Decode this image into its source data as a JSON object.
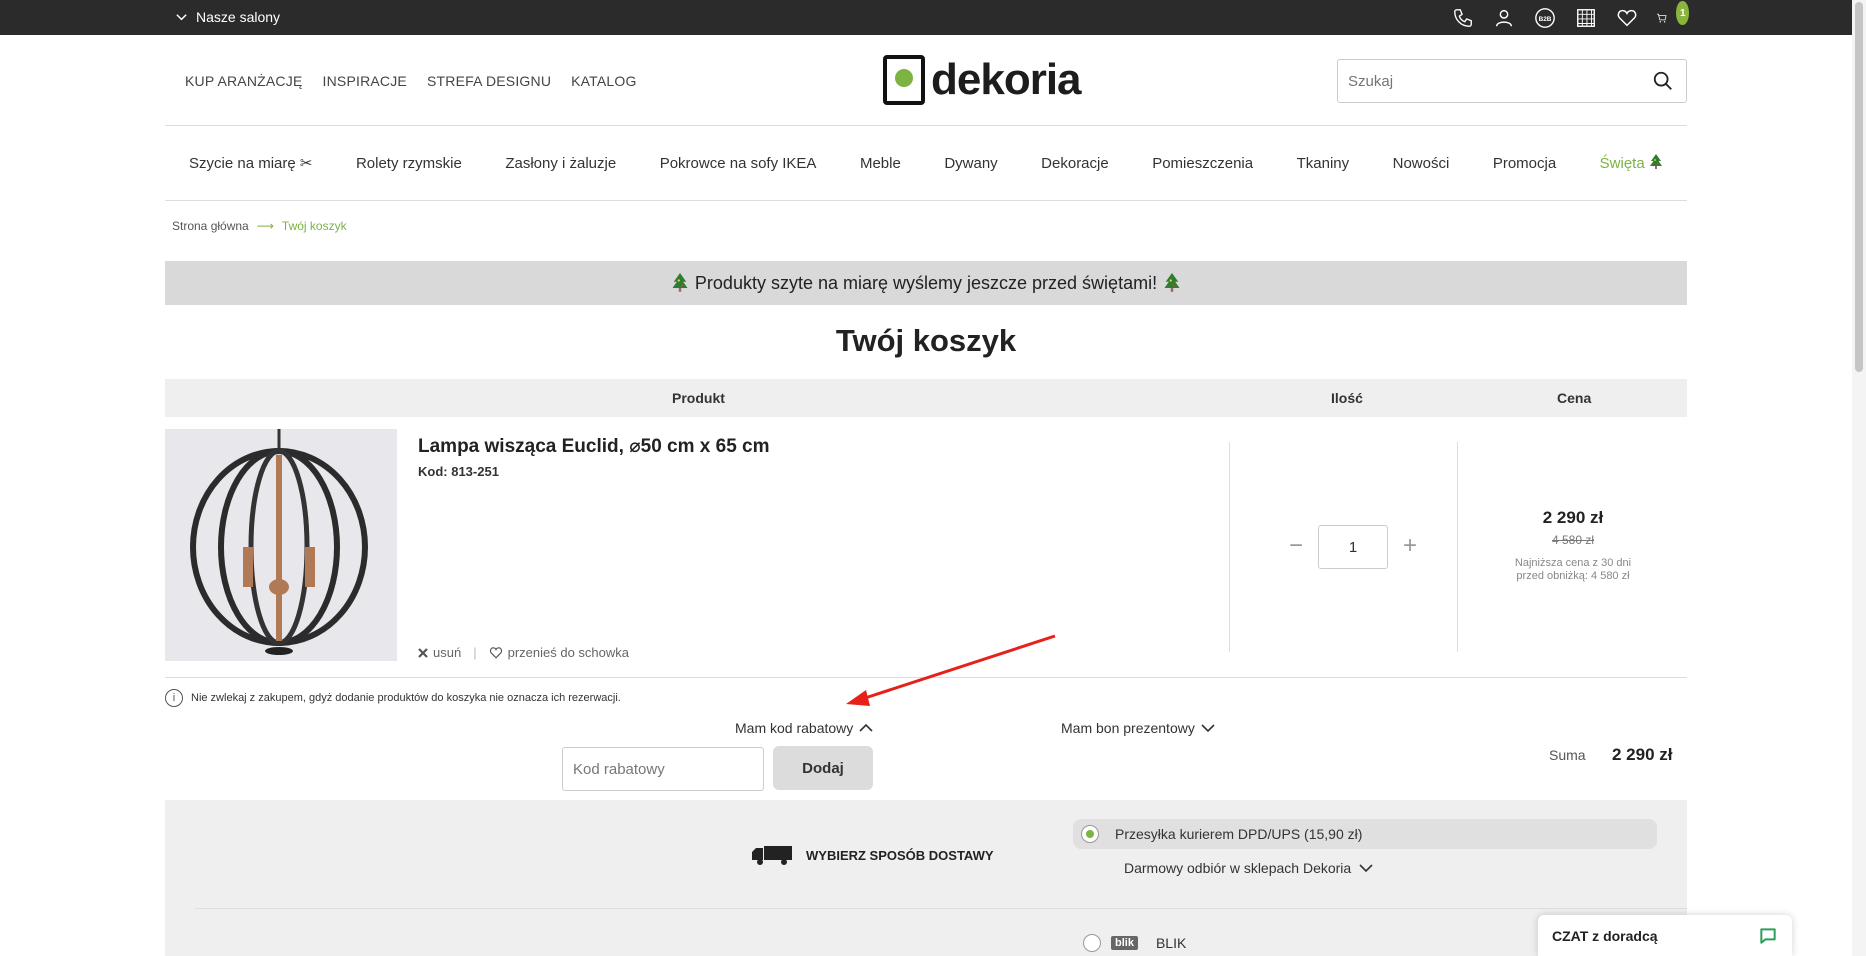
{
  "topbar": {
    "salony_label": "Nasze salony",
    "cart_count": "1",
    "b2b_label": "B2B"
  },
  "header": {
    "links": [
      "KUP ARANŻACJĘ",
      "INSPIRACJE",
      "STREFA DESIGNU",
      "KATALOG"
    ],
    "logo_text": "dekoria",
    "search_placeholder": "Szukaj"
  },
  "nav": {
    "items": [
      "Szycie na miarę ✂",
      "Rolety rzymskie",
      "Zasłony i żaluzje",
      "Pokrowce na sofy IKEA",
      "Meble",
      "Dywany",
      "Dekoracje",
      "Pomieszczenia",
      "Tkaniny",
      "Nowości",
      "Promocja",
      "Święta"
    ]
  },
  "breadcrumb": {
    "home": "Strona główna",
    "separator": "⟶",
    "current": "Twój koszyk"
  },
  "banner": {
    "text": "Produkty szyte na miarę wyślemy jeszcze przed świętami!"
  },
  "page_title": "Twój koszyk",
  "cart": {
    "headers": {
      "product": "Produkt",
      "quantity": "Ilość",
      "price": "Cena"
    },
    "item": {
      "name": "Lampa wisząca Euclid, ⌀50 cm x 65 cm",
      "code": "Kod: 813-251",
      "remove": "usuń",
      "move": "przenieś do schowka",
      "quantity": "1",
      "price": "2 290 zł",
      "old_price": "4 580 zł",
      "lowest_line1": "Najniższa cena z 30 dni",
      "lowest_line2": "przed obniżką: 4 580 zł"
    },
    "notice": "Nie zwlekaj z zakupem, gdyż dodanie produktów do koszyka nie oznacza ich rezerwacji."
  },
  "coupon": {
    "toggle_label": "Mam kod rabatowy",
    "placeholder": "Kod rabatowy",
    "add_label": "Dodaj",
    "voucher_label": "Mam bon prezentowy"
  },
  "summary": {
    "label": "Suma",
    "value": "2 290 zł"
  },
  "delivery": {
    "title": "WYBIERZ SPOSÓB DOSTAWY",
    "selected_option": "Przesyłka kurierem DPD/UPS (15,90 zł)",
    "more_option": "Darmowy odbiór w sklepach Dekoria",
    "blik_logo": "blik",
    "blik_label": "BLIK"
  },
  "chat": {
    "label": "CZAT z doradcą"
  },
  "colors": {
    "accent": "#7cb342",
    "topbar": "#2b2b2b",
    "annotation_arrow": "#e8201a"
  }
}
